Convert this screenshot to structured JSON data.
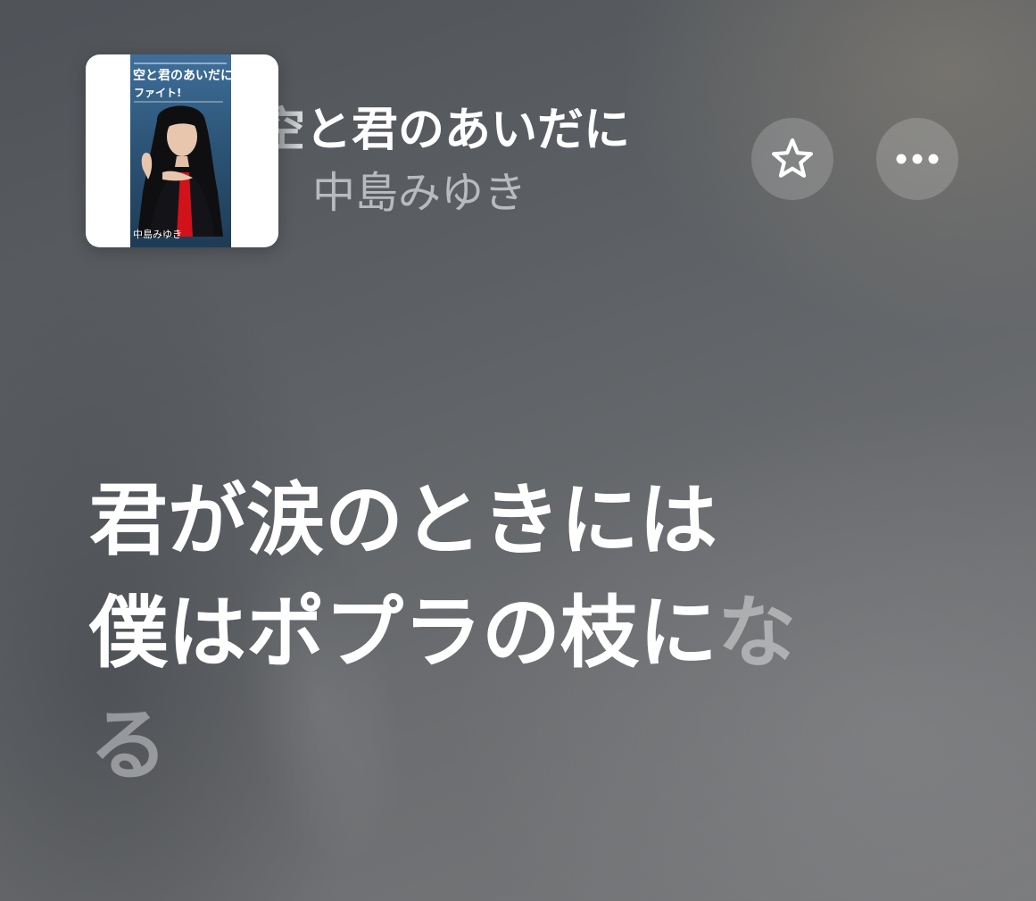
{
  "now_playing": {
    "title": "空と君のあいだに",
    "artist": "中島みゆき"
  },
  "album_art": {
    "cover_title": "空と君のあいだに",
    "cover_subtitle": "ファイト!",
    "cover_artist": "中島みゆき"
  },
  "controls": {
    "favorite_icon": "star-outline-icon",
    "more_icon": "ellipsis-icon"
  },
  "lyrics": {
    "line1": "君が涙のときには",
    "line2_main": "僕はポプラの枝に",
    "line2_tail": "な",
    "line3": "る"
  },
  "colors": {
    "text_primary": "#ffffff",
    "text_secondary": "#c8cbcf",
    "button_fill": "rgba(255,255,255,0.18)",
    "cover_blue": "#2d5578",
    "cover_red": "#d1121b"
  }
}
